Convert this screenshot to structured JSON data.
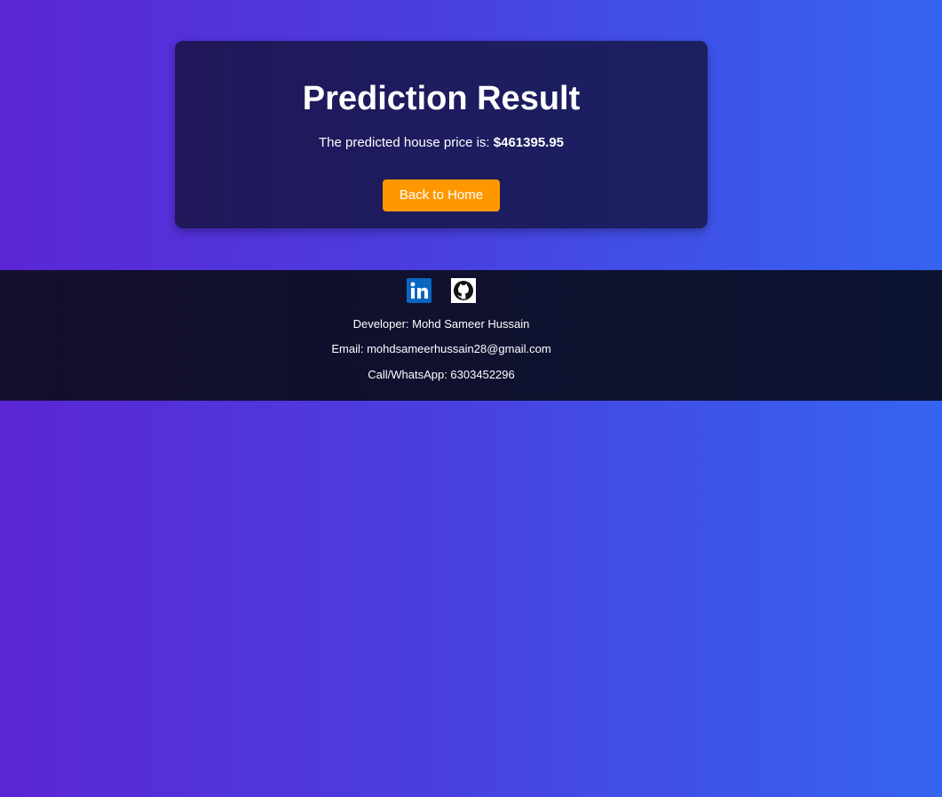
{
  "result": {
    "title": "Prediction Result",
    "prefix": "The predicted house price is:",
    "price": "$461395.95",
    "back_button": "Back to Home"
  },
  "footer": {
    "icons": [
      "linkedin-icon",
      "github-icon"
    ],
    "developer": "Developer: Mohd Sameer Hussain",
    "email": "Email: mohdsameerhussain28@gmail.com",
    "phone": "Call/WhatsApp: 6303452296"
  },
  "colors": {
    "accent_button": "#ff9800",
    "linkedin": "#0a66c2",
    "background_start": "#5b26d6",
    "background_end": "#3564f0"
  }
}
